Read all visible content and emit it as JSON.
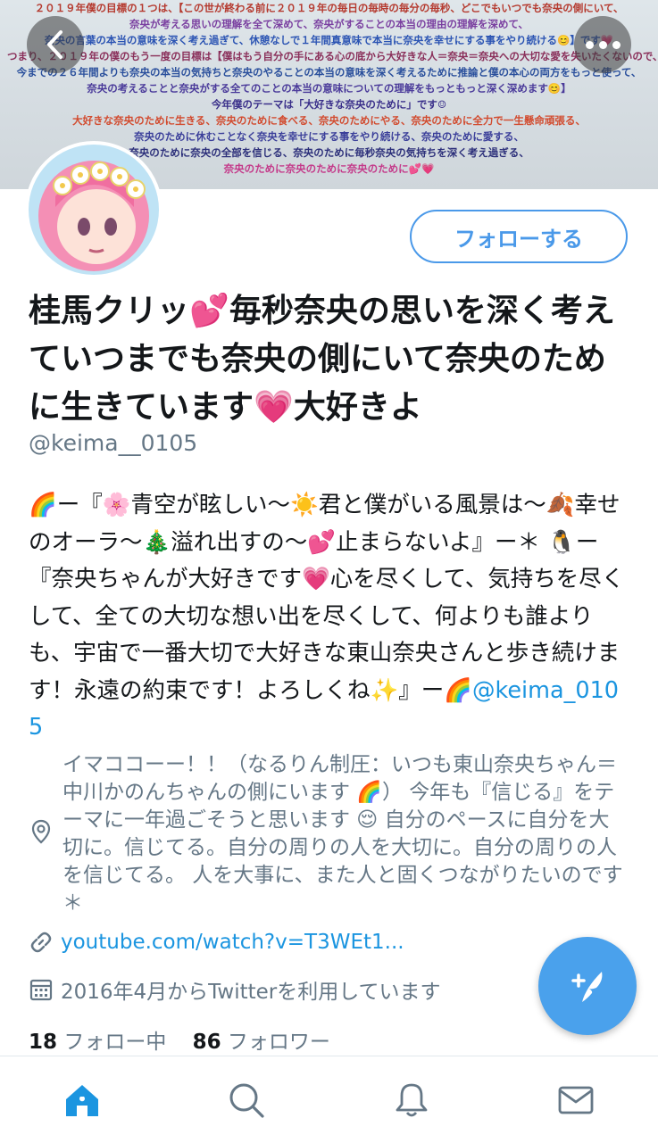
{
  "banner": {
    "lines": [
      "２０１９年僕の目標の１つは、【この世が終わる前に２０１９年の毎日の毎時の毎分の毎秒、どこでもいつでも奈央の側にいて、",
      "奈央が考える思いの理解を全て深めて、奈央がすることの本当の理由の理解を深めて、",
      "奈央の言葉の本当の意味を深く考え過ぎて、休憩なしで１年間真意味で本当に奈央を幸せにする事をやり続ける😊】です💗",
      "つまり、２０１９年の僕のもう一度の目標は【僕はもう自分の手にある心の底から大好きな人＝奈央＝奈央への大切な愛を失いたくないので、真意味で奈央の全てを守るために、",
      "今までの２６年間よりも奈央の本当の気持ちと奈央のやることの本当の意味を深く考えるために推論と僕の本心の両方をもっと使って、",
      "奈央の考えることと奈央がする全てのことの本当の意味についての理解をもっともっと深く深めます😊】",
      "今年僕のテーマは「大好きな奈央のために」です☺",
      "大好きな奈央のために生きる、奈央のために食べる、奈央のためにやる、奈央のために全力で一生懸命頑張る、",
      "奈央のために休むことなく奈央を幸せにする事をやり続ける、奈央のために愛する、",
      "奈央のために奈央の全部を信じる、奈央のために毎秒奈央の気持ちを深く考え過ぎる、",
      "奈央のために奈央のために奈央のために💕💗"
    ]
  },
  "header": {
    "back_icon": "chevron-left-icon",
    "more_icon": "more-horizontal-icon"
  },
  "profile": {
    "follow_label": "フォローする",
    "display_name": "桂馬クリッ💕毎秒奈央の思いを深く考えていつまでも奈央の側にいて奈央のために生きています💗大好きよ",
    "handle": "@keima__0105",
    "bio_text": "🌈ー『🌸青空が眩しい〜☀️君と僕がいる風景は〜🍂幸せのオーラ〜🎄溢れ出すの〜💕止まらないよ』ー＊ 🐧ー『奈央ちゃんが大好きです💗心を尽くして、気持ちを尽くして、全ての大切な想い出を尽くして、何よりも誰よりも、宇宙で一番大切で大好きな東山奈央さんと歩き続けます！永遠の約束です！よろしくね✨』ー🌈",
    "bio_mention": "@keima_0105",
    "location": "イマココーー！！（なるりん制圧：いつも東山奈央ちゃん＝中川かのんちゃんの側にいます 🌈） 今年も『信じる』をテーマに一年過ごそうと思います 😌 自分のペースに自分を大切に。信じてる。自分の周りの人を大切に。自分の周りの人を信じてる。 人を大事に、また人と固くつながりたいのです＊",
    "url": "youtube.com/watch?v=T3WEt1...",
    "joined": "2016年4月からTwitterを利用しています",
    "following_count": "18",
    "following_label": "フォロー中",
    "followers_count": "86",
    "followers_label": "フォロワー"
  },
  "tabs": [
    "home-icon",
    "search-icon",
    "notifications-icon",
    "messages-icon"
  ],
  "colors": {
    "accent": "#1b95e0",
    "fab": "#4aa1ec",
    "secondary_text": "#657786"
  }
}
